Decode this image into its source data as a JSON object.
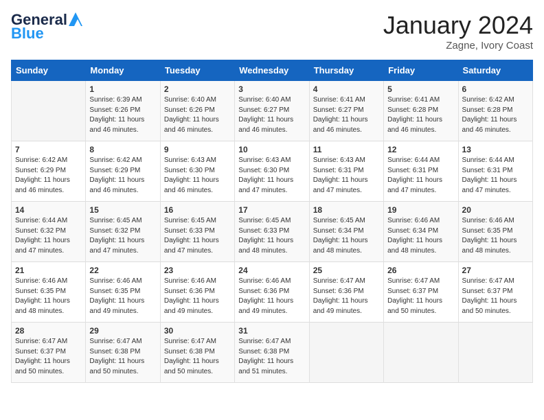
{
  "header": {
    "logo_line1": "General",
    "logo_line2": "Blue",
    "month": "January 2024",
    "location": "Zagne, Ivory Coast"
  },
  "days_of_week": [
    "Sunday",
    "Monday",
    "Tuesday",
    "Wednesday",
    "Thursday",
    "Friday",
    "Saturday"
  ],
  "weeks": [
    [
      {
        "day": "",
        "sunrise": "",
        "sunset": "",
        "daylight": "",
        "empty": true
      },
      {
        "day": "1",
        "sunrise": "Sunrise: 6:39 AM",
        "sunset": "Sunset: 6:26 PM",
        "daylight": "Daylight: 11 hours and 46 minutes."
      },
      {
        "day": "2",
        "sunrise": "Sunrise: 6:40 AM",
        "sunset": "Sunset: 6:26 PM",
        "daylight": "Daylight: 11 hours and 46 minutes."
      },
      {
        "day": "3",
        "sunrise": "Sunrise: 6:40 AM",
        "sunset": "Sunset: 6:27 PM",
        "daylight": "Daylight: 11 hours and 46 minutes."
      },
      {
        "day": "4",
        "sunrise": "Sunrise: 6:41 AM",
        "sunset": "Sunset: 6:27 PM",
        "daylight": "Daylight: 11 hours and 46 minutes."
      },
      {
        "day": "5",
        "sunrise": "Sunrise: 6:41 AM",
        "sunset": "Sunset: 6:28 PM",
        "daylight": "Daylight: 11 hours and 46 minutes."
      },
      {
        "day": "6",
        "sunrise": "Sunrise: 6:42 AM",
        "sunset": "Sunset: 6:28 PM",
        "daylight": "Daylight: 11 hours and 46 minutes."
      }
    ],
    [
      {
        "day": "7",
        "sunrise": "Sunrise: 6:42 AM",
        "sunset": "Sunset: 6:29 PM",
        "daylight": "Daylight: 11 hours and 46 minutes."
      },
      {
        "day": "8",
        "sunrise": "Sunrise: 6:42 AM",
        "sunset": "Sunset: 6:29 PM",
        "daylight": "Daylight: 11 hours and 46 minutes."
      },
      {
        "day": "9",
        "sunrise": "Sunrise: 6:43 AM",
        "sunset": "Sunset: 6:30 PM",
        "daylight": "Daylight: 11 hours and 46 minutes."
      },
      {
        "day": "10",
        "sunrise": "Sunrise: 6:43 AM",
        "sunset": "Sunset: 6:30 PM",
        "daylight": "Daylight: 11 hours and 47 minutes."
      },
      {
        "day": "11",
        "sunrise": "Sunrise: 6:43 AM",
        "sunset": "Sunset: 6:31 PM",
        "daylight": "Daylight: 11 hours and 47 minutes."
      },
      {
        "day": "12",
        "sunrise": "Sunrise: 6:44 AM",
        "sunset": "Sunset: 6:31 PM",
        "daylight": "Daylight: 11 hours and 47 minutes."
      },
      {
        "day": "13",
        "sunrise": "Sunrise: 6:44 AM",
        "sunset": "Sunset: 6:31 PM",
        "daylight": "Daylight: 11 hours and 47 minutes."
      }
    ],
    [
      {
        "day": "14",
        "sunrise": "Sunrise: 6:44 AM",
        "sunset": "Sunset: 6:32 PM",
        "daylight": "Daylight: 11 hours and 47 minutes."
      },
      {
        "day": "15",
        "sunrise": "Sunrise: 6:45 AM",
        "sunset": "Sunset: 6:32 PM",
        "daylight": "Daylight: 11 hours and 47 minutes."
      },
      {
        "day": "16",
        "sunrise": "Sunrise: 6:45 AM",
        "sunset": "Sunset: 6:33 PM",
        "daylight": "Daylight: 11 hours and 47 minutes."
      },
      {
        "day": "17",
        "sunrise": "Sunrise: 6:45 AM",
        "sunset": "Sunset: 6:33 PM",
        "daylight": "Daylight: 11 hours and 48 minutes."
      },
      {
        "day": "18",
        "sunrise": "Sunrise: 6:45 AM",
        "sunset": "Sunset: 6:34 PM",
        "daylight": "Daylight: 11 hours and 48 minutes."
      },
      {
        "day": "19",
        "sunrise": "Sunrise: 6:46 AM",
        "sunset": "Sunset: 6:34 PM",
        "daylight": "Daylight: 11 hours and 48 minutes."
      },
      {
        "day": "20",
        "sunrise": "Sunrise: 6:46 AM",
        "sunset": "Sunset: 6:35 PM",
        "daylight": "Daylight: 11 hours and 48 minutes."
      }
    ],
    [
      {
        "day": "21",
        "sunrise": "Sunrise: 6:46 AM",
        "sunset": "Sunset: 6:35 PM",
        "daylight": "Daylight: 11 hours and 48 minutes."
      },
      {
        "day": "22",
        "sunrise": "Sunrise: 6:46 AM",
        "sunset": "Sunset: 6:35 PM",
        "daylight": "Daylight: 11 hours and 49 minutes."
      },
      {
        "day": "23",
        "sunrise": "Sunrise: 6:46 AM",
        "sunset": "Sunset: 6:36 PM",
        "daylight": "Daylight: 11 hours and 49 minutes."
      },
      {
        "day": "24",
        "sunrise": "Sunrise: 6:46 AM",
        "sunset": "Sunset: 6:36 PM",
        "daylight": "Daylight: 11 hours and 49 minutes."
      },
      {
        "day": "25",
        "sunrise": "Sunrise: 6:47 AM",
        "sunset": "Sunset: 6:36 PM",
        "daylight": "Daylight: 11 hours and 49 minutes."
      },
      {
        "day": "26",
        "sunrise": "Sunrise: 6:47 AM",
        "sunset": "Sunset: 6:37 PM",
        "daylight": "Daylight: 11 hours and 50 minutes."
      },
      {
        "day": "27",
        "sunrise": "Sunrise: 6:47 AM",
        "sunset": "Sunset: 6:37 PM",
        "daylight": "Daylight: 11 hours and 50 minutes."
      }
    ],
    [
      {
        "day": "28",
        "sunrise": "Sunrise: 6:47 AM",
        "sunset": "Sunset: 6:37 PM",
        "daylight": "Daylight: 11 hours and 50 minutes."
      },
      {
        "day": "29",
        "sunrise": "Sunrise: 6:47 AM",
        "sunset": "Sunset: 6:38 PM",
        "daylight": "Daylight: 11 hours and 50 minutes."
      },
      {
        "day": "30",
        "sunrise": "Sunrise: 6:47 AM",
        "sunset": "Sunset: 6:38 PM",
        "daylight": "Daylight: 11 hours and 50 minutes."
      },
      {
        "day": "31",
        "sunrise": "Sunrise: 6:47 AM",
        "sunset": "Sunset: 6:38 PM",
        "daylight": "Daylight: 11 hours and 51 minutes."
      },
      {
        "day": "",
        "empty": true
      },
      {
        "day": "",
        "empty": true
      },
      {
        "day": "",
        "empty": true
      }
    ]
  ]
}
